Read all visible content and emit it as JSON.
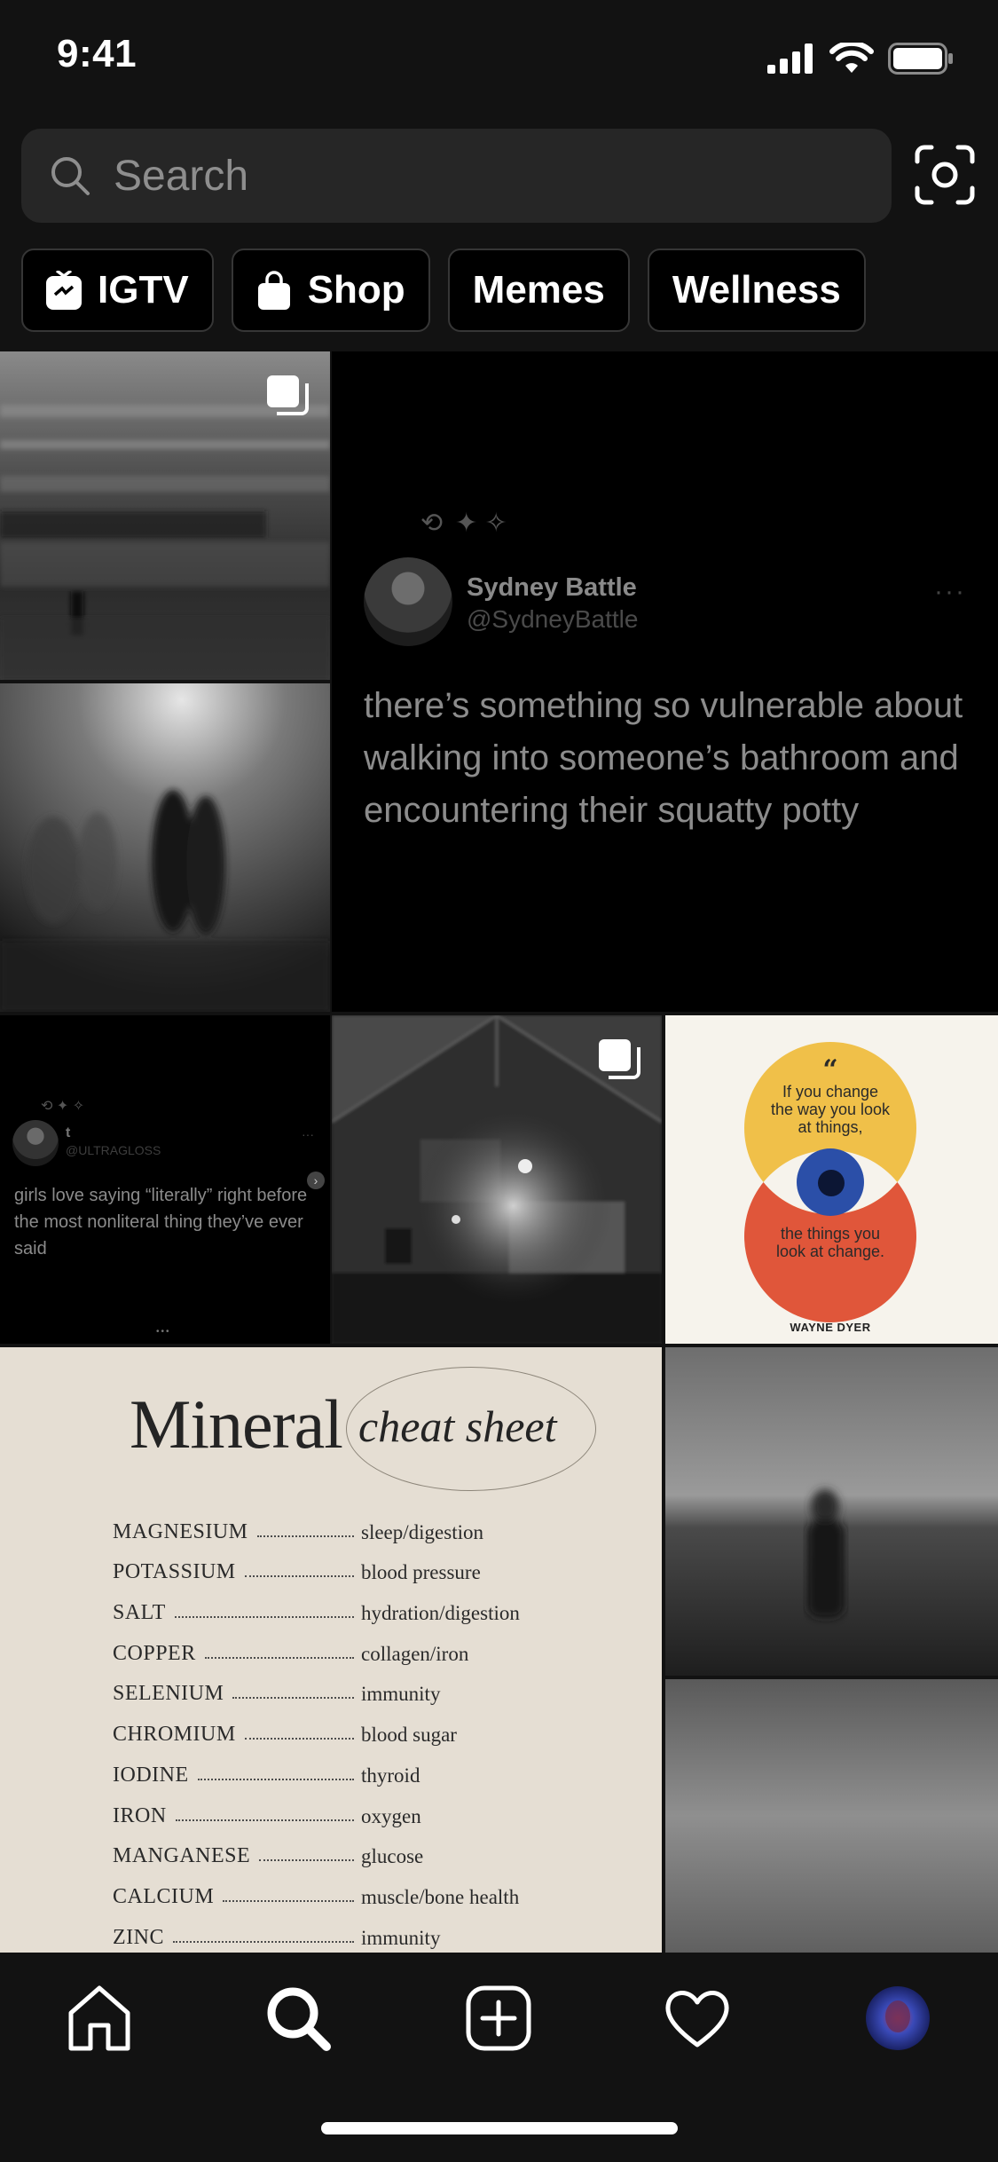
{
  "status_bar": {
    "time": "9:41"
  },
  "search": {
    "placeholder": "Search"
  },
  "chips": [
    {
      "label": "IGTV",
      "icon": "igtv-icon"
    },
    {
      "label": "Shop",
      "icon": "shop-bag-icon"
    },
    {
      "label": "Memes",
      "icon": ""
    },
    {
      "label": "Wellness",
      "icon": ""
    }
  ],
  "tweet_large": {
    "name": "Sydney Battle",
    "handle": "@SydneyBattle",
    "text": "there’s something so vulnerable about walking into someone’s bathroom and encountering their squatty potty",
    "more": "···"
  },
  "tweet_small": {
    "name": "t",
    "handle": "@ULTRAGLOSS",
    "text": "girls love saying “literally” right before the most nonliteral thing they’ve ever said"
  },
  "quote": {
    "mark": "“",
    "line1": "If you change the way you look at things,",
    "line2": "the things you look at change.",
    "author": "WAYNE DYER"
  },
  "mineral": {
    "title": "Mineral",
    "subtitle": "cheat sheet",
    "rows": [
      {
        "name": "MAGNESIUM",
        "use": "sleep/digestion"
      },
      {
        "name": "POTASSIUM",
        "use": "blood pressure"
      },
      {
        "name": "SALT",
        "use": "hydration/digestion"
      },
      {
        "name": "COPPER",
        "use": "collagen/iron"
      },
      {
        "name": "SELENIUM",
        "use": "immunity"
      },
      {
        "name": "CHROMIUM",
        "use": "blood sugar"
      },
      {
        "name": "IODINE",
        "use": "thyroid"
      },
      {
        "name": "IRON",
        "use": "oxygen"
      },
      {
        "name": "MANGANESE",
        "use": "glucose"
      },
      {
        "name": "CALCIUM",
        "use": "muscle/bone health"
      },
      {
        "name": "ZINC",
        "use": "immunity"
      }
    ]
  },
  "tabs": [
    {
      "name": "home"
    },
    {
      "name": "search"
    },
    {
      "name": "new-post"
    },
    {
      "name": "activity"
    },
    {
      "name": "profile"
    }
  ],
  "colors": {
    "background": "#121212",
    "search_bg": "#262626",
    "quote_yellow": "#f0c049",
    "quote_red": "#e0563a",
    "quote_blue": "#2b4fa8",
    "mineral_bg": "#e5ded3"
  }
}
